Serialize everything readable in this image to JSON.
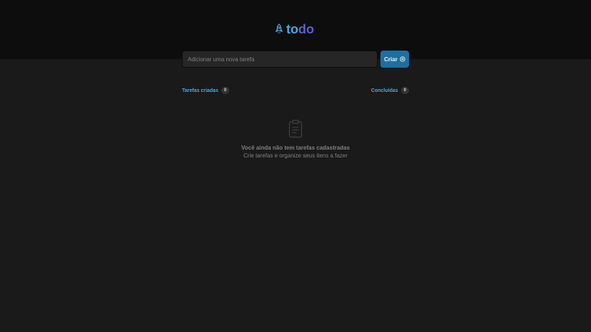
{
  "header": {
    "logo_icon": "rocket-icon",
    "logo_part1": "to",
    "logo_part2": "do"
  },
  "new_task": {
    "placeholder": "Adicionar uma nova tarefa",
    "value": "",
    "create_label": "Criar",
    "create_icon": "plus-circle-icon"
  },
  "counters": {
    "created_label": "Tarefas criadas",
    "created_count": "0",
    "done_label": "Concluídas",
    "done_count": "0"
  },
  "empty_state": {
    "icon": "clipboard-icon",
    "title": "Você ainda não tem tarefas cadastradas",
    "subtitle": "Crie tarefas e organize seus itens a fazer"
  },
  "colors": {
    "background": "#1a1a1a",
    "header": "#0d0d0d",
    "blue": "#4ea8de",
    "purple": "#5e60ce",
    "button": "#1e6f9f",
    "input": "#262626",
    "gray": "#808080"
  }
}
